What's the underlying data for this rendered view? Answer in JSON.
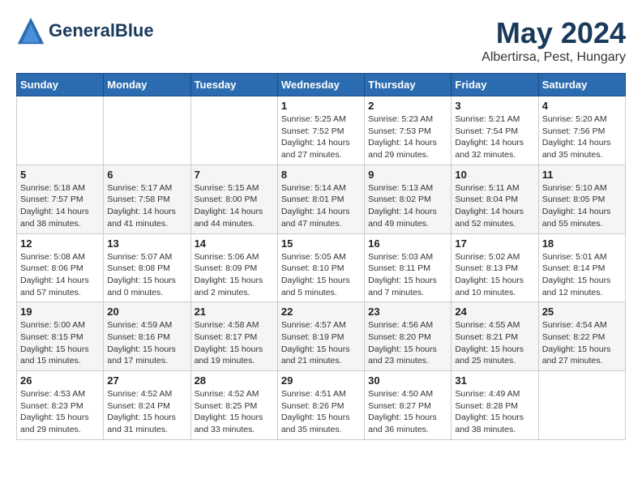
{
  "app": {
    "name": "GeneralBlue",
    "logo_icon": "triangle"
  },
  "calendar": {
    "month": "May 2024",
    "location": "Albertirsa, Pest, Hungary",
    "days_of_week": [
      "Sunday",
      "Monday",
      "Tuesday",
      "Wednesday",
      "Thursday",
      "Friday",
      "Saturday"
    ],
    "weeks": [
      [
        {
          "day": "",
          "info": ""
        },
        {
          "day": "",
          "info": ""
        },
        {
          "day": "",
          "info": ""
        },
        {
          "day": "1",
          "info": "Sunrise: 5:25 AM\nSunset: 7:52 PM\nDaylight: 14 hours\nand 27 minutes."
        },
        {
          "day": "2",
          "info": "Sunrise: 5:23 AM\nSunset: 7:53 PM\nDaylight: 14 hours\nand 29 minutes."
        },
        {
          "day": "3",
          "info": "Sunrise: 5:21 AM\nSunset: 7:54 PM\nDaylight: 14 hours\nand 32 minutes."
        },
        {
          "day": "4",
          "info": "Sunrise: 5:20 AM\nSunset: 7:56 PM\nDaylight: 14 hours\nand 35 minutes."
        }
      ],
      [
        {
          "day": "5",
          "info": "Sunrise: 5:18 AM\nSunset: 7:57 PM\nDaylight: 14 hours\nand 38 minutes."
        },
        {
          "day": "6",
          "info": "Sunrise: 5:17 AM\nSunset: 7:58 PM\nDaylight: 14 hours\nand 41 minutes."
        },
        {
          "day": "7",
          "info": "Sunrise: 5:15 AM\nSunset: 8:00 PM\nDaylight: 14 hours\nand 44 minutes."
        },
        {
          "day": "8",
          "info": "Sunrise: 5:14 AM\nSunset: 8:01 PM\nDaylight: 14 hours\nand 47 minutes."
        },
        {
          "day": "9",
          "info": "Sunrise: 5:13 AM\nSunset: 8:02 PM\nDaylight: 14 hours\nand 49 minutes."
        },
        {
          "day": "10",
          "info": "Sunrise: 5:11 AM\nSunset: 8:04 PM\nDaylight: 14 hours\nand 52 minutes."
        },
        {
          "day": "11",
          "info": "Sunrise: 5:10 AM\nSunset: 8:05 PM\nDaylight: 14 hours\nand 55 minutes."
        }
      ],
      [
        {
          "day": "12",
          "info": "Sunrise: 5:08 AM\nSunset: 8:06 PM\nDaylight: 14 hours\nand 57 minutes."
        },
        {
          "day": "13",
          "info": "Sunrise: 5:07 AM\nSunset: 8:08 PM\nDaylight: 15 hours\nand 0 minutes."
        },
        {
          "day": "14",
          "info": "Sunrise: 5:06 AM\nSunset: 8:09 PM\nDaylight: 15 hours\nand 2 minutes."
        },
        {
          "day": "15",
          "info": "Sunrise: 5:05 AM\nSunset: 8:10 PM\nDaylight: 15 hours\nand 5 minutes."
        },
        {
          "day": "16",
          "info": "Sunrise: 5:03 AM\nSunset: 8:11 PM\nDaylight: 15 hours\nand 7 minutes."
        },
        {
          "day": "17",
          "info": "Sunrise: 5:02 AM\nSunset: 8:13 PM\nDaylight: 15 hours\nand 10 minutes."
        },
        {
          "day": "18",
          "info": "Sunrise: 5:01 AM\nSunset: 8:14 PM\nDaylight: 15 hours\nand 12 minutes."
        }
      ],
      [
        {
          "day": "19",
          "info": "Sunrise: 5:00 AM\nSunset: 8:15 PM\nDaylight: 15 hours\nand 15 minutes."
        },
        {
          "day": "20",
          "info": "Sunrise: 4:59 AM\nSunset: 8:16 PM\nDaylight: 15 hours\nand 17 minutes."
        },
        {
          "day": "21",
          "info": "Sunrise: 4:58 AM\nSunset: 8:17 PM\nDaylight: 15 hours\nand 19 minutes."
        },
        {
          "day": "22",
          "info": "Sunrise: 4:57 AM\nSunset: 8:19 PM\nDaylight: 15 hours\nand 21 minutes."
        },
        {
          "day": "23",
          "info": "Sunrise: 4:56 AM\nSunset: 8:20 PM\nDaylight: 15 hours\nand 23 minutes."
        },
        {
          "day": "24",
          "info": "Sunrise: 4:55 AM\nSunset: 8:21 PM\nDaylight: 15 hours\nand 25 minutes."
        },
        {
          "day": "25",
          "info": "Sunrise: 4:54 AM\nSunset: 8:22 PM\nDaylight: 15 hours\nand 27 minutes."
        }
      ],
      [
        {
          "day": "26",
          "info": "Sunrise: 4:53 AM\nSunset: 8:23 PM\nDaylight: 15 hours\nand 29 minutes."
        },
        {
          "day": "27",
          "info": "Sunrise: 4:52 AM\nSunset: 8:24 PM\nDaylight: 15 hours\nand 31 minutes."
        },
        {
          "day": "28",
          "info": "Sunrise: 4:52 AM\nSunset: 8:25 PM\nDaylight: 15 hours\nand 33 minutes."
        },
        {
          "day": "29",
          "info": "Sunrise: 4:51 AM\nSunset: 8:26 PM\nDaylight: 15 hours\nand 35 minutes."
        },
        {
          "day": "30",
          "info": "Sunrise: 4:50 AM\nSunset: 8:27 PM\nDaylight: 15 hours\nand 36 minutes."
        },
        {
          "day": "31",
          "info": "Sunrise: 4:49 AM\nSunset: 8:28 PM\nDaylight: 15 hours\nand 38 minutes."
        },
        {
          "day": "",
          "info": ""
        }
      ]
    ]
  }
}
